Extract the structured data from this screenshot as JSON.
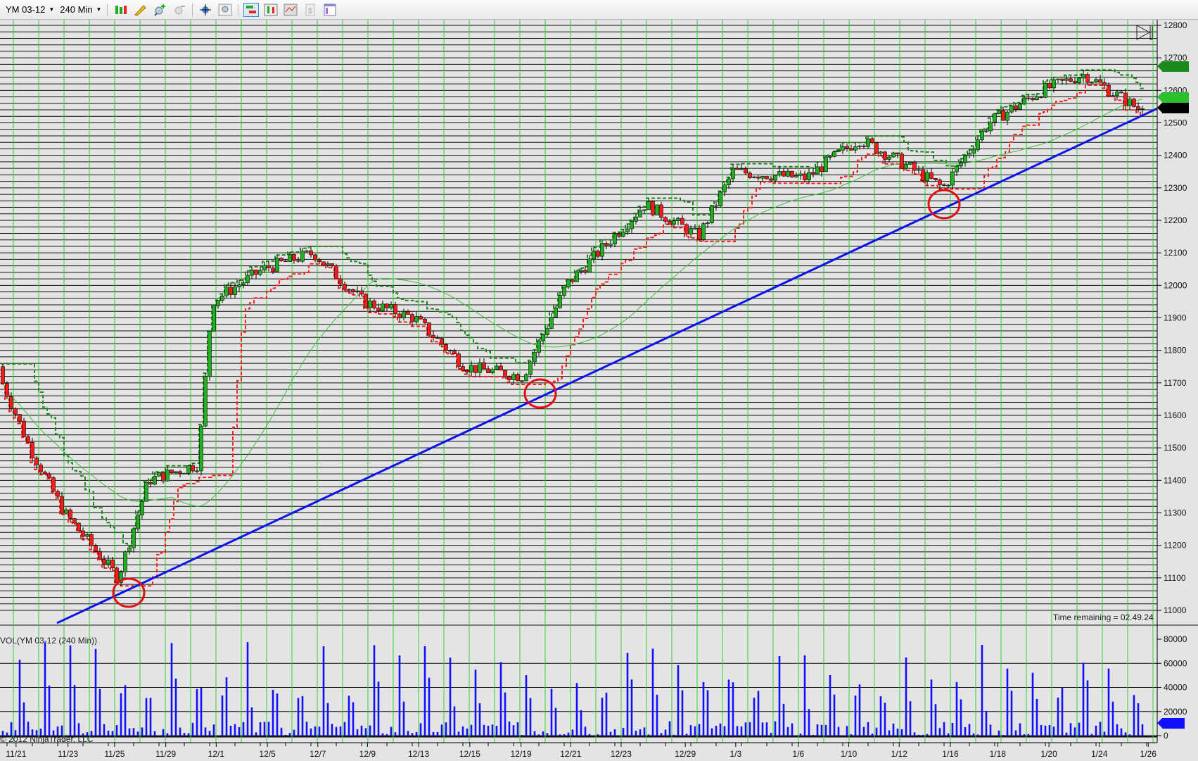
{
  "toolbar": {
    "instrument": "YM 03-12",
    "interval": "240 Min",
    "icons": [
      "bar-type-icon",
      "drawing-pencil-icon",
      "zoom-in-icon",
      "zoom-out-icon",
      "crosshair-icon",
      "zoom-box-icon",
      "chart-trader-icon",
      "indicators-icon",
      "strategies-icon",
      "dollar-icon",
      "data-box-icon"
    ]
  },
  "chart": {
    "price_ticks": [
      "12800",
      "12700",
      "12600",
      "12500",
      "12400",
      "12300",
      "12200",
      "12100",
      "12000",
      "11900",
      "11800",
      "11700",
      "11600",
      "11500",
      "11400",
      "11300",
      "11200",
      "11100",
      "11000"
    ],
    "price_markers": {
      "upper_channel": "12670",
      "moving_average": "12576",
      "last_price": "12544"
    },
    "time_remaining": "Time remaining = 02.49.24",
    "volume_label": "VOL(YM 03-12 (240 Min))",
    "volume_ticks": [
      "80000",
      "60000",
      "40000",
      "20000",
      "0"
    ],
    "volume_marker": "9460",
    "copyright": "© 2012 NinjaTrader, LLC",
    "date_labels": [
      "11/21",
      "11/23",
      "11/25",
      "11/29",
      "12/1",
      "12/5",
      "12/7",
      "12/9",
      "12/13",
      "12/15",
      "12/19",
      "12/21",
      "12/23",
      "12/29",
      "1/3",
      "1/6",
      "1/10",
      "1/12",
      "1/16",
      "1/18",
      "1/20",
      "1/24",
      "1/26"
    ],
    "colors": {
      "up": "#22b022",
      "down": "#ff1a1a",
      "trendline": "#0a14f0",
      "grid_vertical": "#33cc33",
      "volume": "#1010ff",
      "circle": "#e01010"
    }
  },
  "chart_data": {
    "type": "candlestick",
    "title": "YM 03-12 (240 Min)",
    "ylim": [
      11000,
      12800
    ],
    "keypoints": [
      {
        "date": "11/21",
        "price": 11750
      },
      {
        "date": "11/22",
        "price": 11500
      },
      {
        "date": "11/23",
        "price": 11300
      },
      {
        "date": "11/25",
        "price": 11100
      },
      {
        "date": "11/28",
        "price": 11400
      },
      {
        "date": "11/30",
        "price": 11450
      },
      {
        "date": "12/1",
        "price": 11950
      },
      {
        "date": "12/5",
        "price": 12050
      },
      {
        "date": "12/7",
        "price": 12100
      },
      {
        "date": "12/9",
        "price": 11950
      },
      {
        "date": "12/13",
        "price": 11900
      },
      {
        "date": "12/15",
        "price": 11750
      },
      {
        "date": "12/19",
        "price": 11720
      },
      {
        "date": "12/21",
        "price": 12000
      },
      {
        "date": "12/23",
        "price": 12250
      },
      {
        "date": "12/29",
        "price": 12150
      },
      {
        "date": "1/3",
        "price": 12350
      },
      {
        "date": "1/6",
        "price": 12330
      },
      {
        "date": "1/10",
        "price": 12450
      },
      {
        "date": "1/12",
        "price": 12400
      },
      {
        "date": "1/16",
        "price": 12300
      },
      {
        "date": "1/18",
        "price": 12500
      },
      {
        "date": "1/20",
        "price": 12600
      },
      {
        "date": "1/24",
        "price": 12650
      },
      {
        "date": "1/26",
        "price": 12544
      }
    ],
    "trendline": {
      "from": {
        "date": "11/25",
        "price": 11080
      },
      "to": {
        "date": "1/26",
        "price": 12544
      }
    },
    "volume_ylim": [
      0,
      80000
    ]
  }
}
